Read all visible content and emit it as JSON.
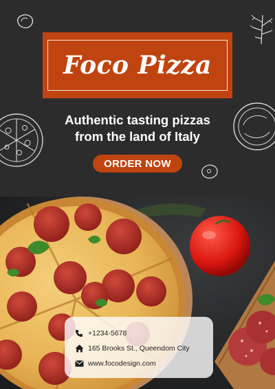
{
  "brand": {
    "title": "Foco Pizza"
  },
  "tagline": {
    "line1": "Authentic tasting pizzas",
    "line2": "from the land of Italy"
  },
  "cta": {
    "label": "ORDER NOW"
  },
  "contact": {
    "phone": "+1234-5678",
    "address": "165 Brooks St., Queendom City",
    "website": "www.focodesign.com"
  },
  "colors": {
    "accent": "#c0440f",
    "background": "#2d2c2d",
    "card": "#ffffff"
  },
  "icons": [
    "phone-icon",
    "home-icon",
    "mail-icon"
  ]
}
